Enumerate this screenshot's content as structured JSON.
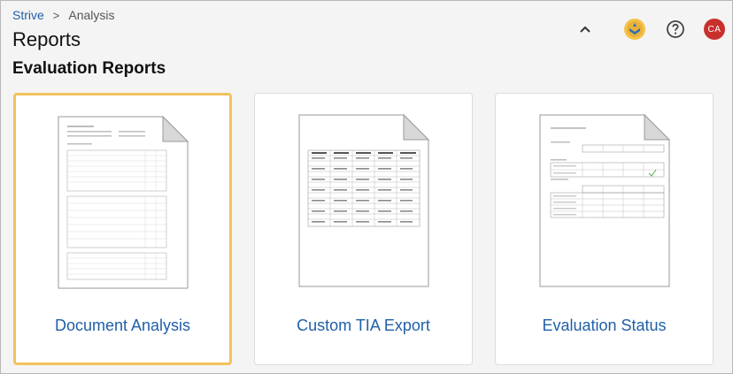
{
  "breadcrumb": {
    "root": "Strive",
    "separator": ">",
    "current": "Analysis"
  },
  "page": {
    "title": "Reports",
    "section": "Evaluation Reports"
  },
  "header": {
    "avatar_initials": "CA",
    "avatar_color": "#c9302c"
  },
  "cards": [
    {
      "label": "Document Analysis",
      "selected": true
    },
    {
      "label": "Custom TIA Export",
      "selected": false
    },
    {
      "label": "Evaluation Status",
      "selected": false
    }
  ],
  "colors": {
    "link": "#1f5fa8",
    "selected_border": "#f2c260"
  }
}
